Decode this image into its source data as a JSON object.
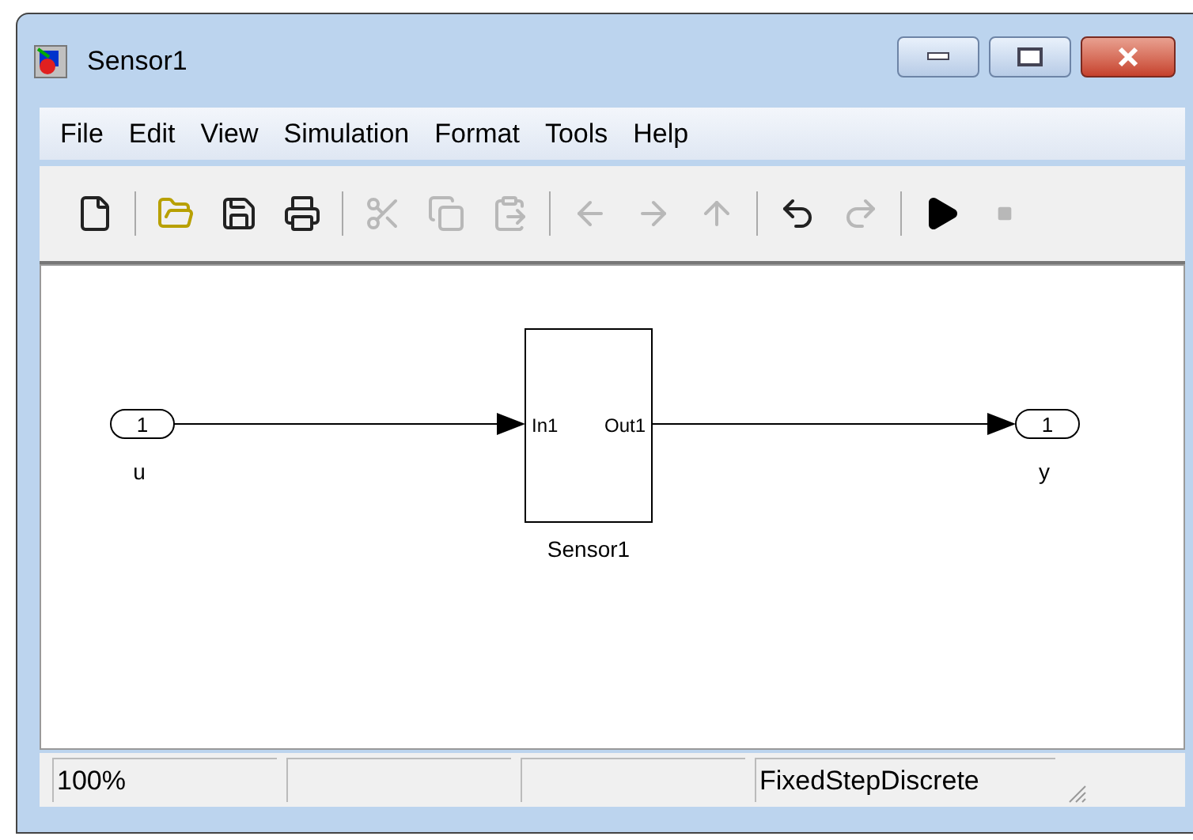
{
  "window": {
    "title": "Sensor1"
  },
  "menu": [
    "File",
    "Edit",
    "View",
    "Simulation",
    "Format",
    "Tools",
    "Help"
  ],
  "toolbar": [
    {
      "kind": "new",
      "disabled": false
    },
    {
      "kind": "sep"
    },
    {
      "kind": "open",
      "disabled": false
    },
    {
      "kind": "save",
      "disabled": false
    },
    {
      "kind": "print",
      "disabled": false
    },
    {
      "kind": "sep"
    },
    {
      "kind": "cut",
      "disabled": true
    },
    {
      "kind": "copy",
      "disabled": true
    },
    {
      "kind": "paste",
      "disabled": true
    },
    {
      "kind": "sep"
    },
    {
      "kind": "back",
      "disabled": true
    },
    {
      "kind": "forward",
      "disabled": true
    },
    {
      "kind": "up",
      "disabled": true
    },
    {
      "kind": "sep"
    },
    {
      "kind": "undo",
      "disabled": false
    },
    {
      "kind": "redo",
      "disabled": true
    },
    {
      "kind": "sep"
    },
    {
      "kind": "play",
      "disabled": false
    },
    {
      "kind": "stop",
      "disabled": true
    }
  ],
  "diagram": {
    "inport": {
      "number": "1",
      "label": "u"
    },
    "block": {
      "name": "Sensor1",
      "input": "In1",
      "output": "Out1"
    },
    "outport": {
      "number": "1",
      "label": "y"
    }
  },
  "status_bar": {
    "zoom": "100%",
    "solver": "FixedStepDiscrete"
  }
}
